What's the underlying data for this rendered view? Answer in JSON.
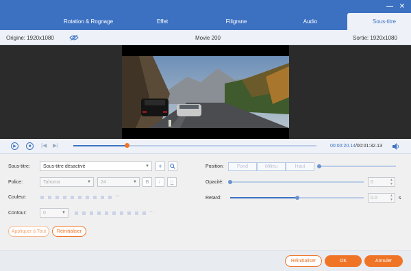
{
  "window": {
    "tabs": [
      "Rotation & Rognage",
      "Effet",
      "Filigrane",
      "Audio",
      "Sous-titre"
    ],
    "active_tab": "Sous-titre",
    "accent_color": "#3c71c2",
    "action_color": "#f07426"
  },
  "info": {
    "origin": "Origine: 1920x1080",
    "movie": "Movie 200",
    "output": "Sortie: 1920x1080"
  },
  "player": {
    "current_time": "00:00:20.14",
    "total_time": "/00:01:32.13",
    "progress_fraction": 0.22
  },
  "subtitle": {
    "label": "Sous-titre:",
    "value": "Sous-titre désactivé",
    "font_label": "Police:",
    "font_value": "Tahoma",
    "size_value": "24",
    "bold": "B",
    "italic": "I",
    "underline": "U",
    "color_label": "Couleur:",
    "outline_label": "Contour:",
    "outline_value": "0",
    "more": "···"
  },
  "position": {
    "label": "Position:",
    "options": [
      "Fond",
      "Milieu",
      "Haut"
    ]
  },
  "opacity": {
    "label": "Opacité:",
    "value": "0",
    "level": 0
  },
  "delay": {
    "label": "Retard:",
    "value": "0.0",
    "unit": "s",
    "level": 0.5
  },
  "panel_buttons": {
    "apply_all": "Appliquer à Tout",
    "reset": "Réinitialiser"
  },
  "footer": {
    "reset": "Réinitialiser",
    "ok": "OK",
    "cancel": "Annuler"
  }
}
